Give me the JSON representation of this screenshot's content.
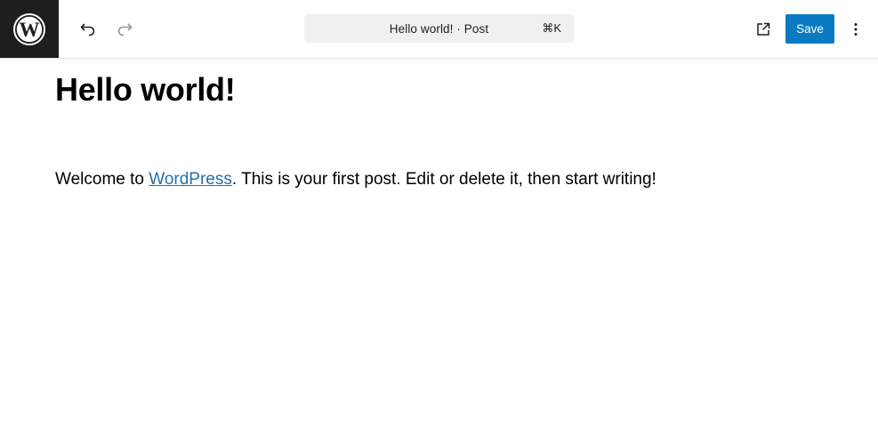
{
  "header": {
    "logo_icon": "wordpress-logo-icon",
    "undo_icon": "undo-icon",
    "redo_icon": "redo-icon",
    "command_bar": {
      "title": "Hello world! · Post",
      "shortcut": "⌘K"
    },
    "view_icon": "external-link-icon",
    "save_label": "Save",
    "more_icon": "more-vertical-icon"
  },
  "colors": {
    "accent": "#0a7bc2",
    "logo_bg": "#1e1e1e",
    "link": "#2271b1",
    "command_bg": "#f0f0f0"
  },
  "post": {
    "title": "Hello world!",
    "paragraph_before": "Welcome to ",
    "paragraph_link": "WordPress",
    "paragraph_after": ". This is your first post. Edit or delete it, then start writing!"
  }
}
